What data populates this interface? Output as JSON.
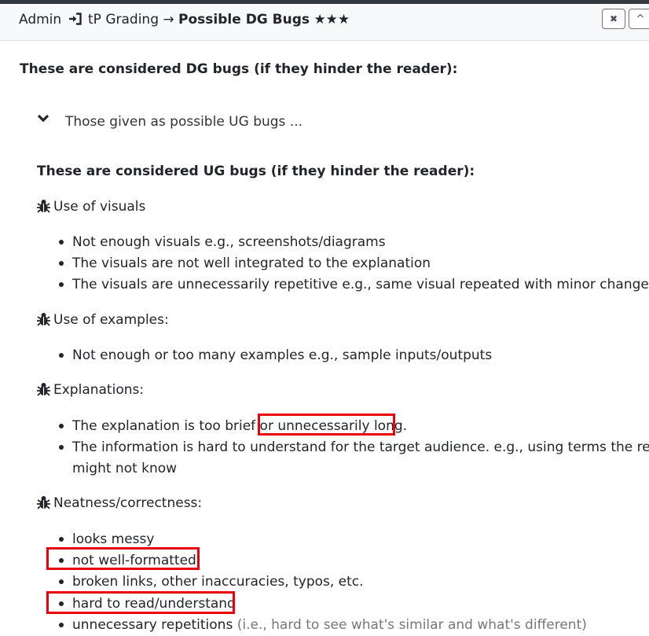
{
  "header": {
    "crumb_root": "Admin",
    "crumb_mid": "tP Grading →",
    "title": "Possible DG Bugs",
    "stars": "★★★",
    "close_label": "✖",
    "collapse_label": "^"
  },
  "intro": "These are considered DG bugs (if they hinder the reader):",
  "collapsible": {
    "label": "Those given as possible UG bugs ..."
  },
  "ug_heading": "These are considered UG bugs (if they hinder the reader):",
  "sections": [
    {
      "label": "Use of visuals",
      "items": [
        "Not enough visuals e.g., screenshots/diagrams",
        "The visuals are not well integrated to the explanation",
        "The visuals are unnecessarily repetitive e.g., same visual repeated with minor changes"
      ]
    },
    {
      "label": "Use of examples:",
      "items": [
        "Not enough or too many examples e.g., sample inputs/outputs"
      ]
    },
    {
      "label": "Explanations:",
      "items": [
        "The explanation is too brief or unnecessarily long.",
        "The information is hard to understand for the target audience. e.g., using terms the reader",
        "might not know"
      ]
    },
    {
      "label": "Neatness/correctness:",
      "items": [
        "looks messy",
        "not well-formatted",
        "broken links, other inaccuracies, typos, etc.",
        "hard to read/understand",
        "unnecessary repetitions",
        "(i.e., hard to see what's similar and what's different)"
      ]
    }
  ]
}
